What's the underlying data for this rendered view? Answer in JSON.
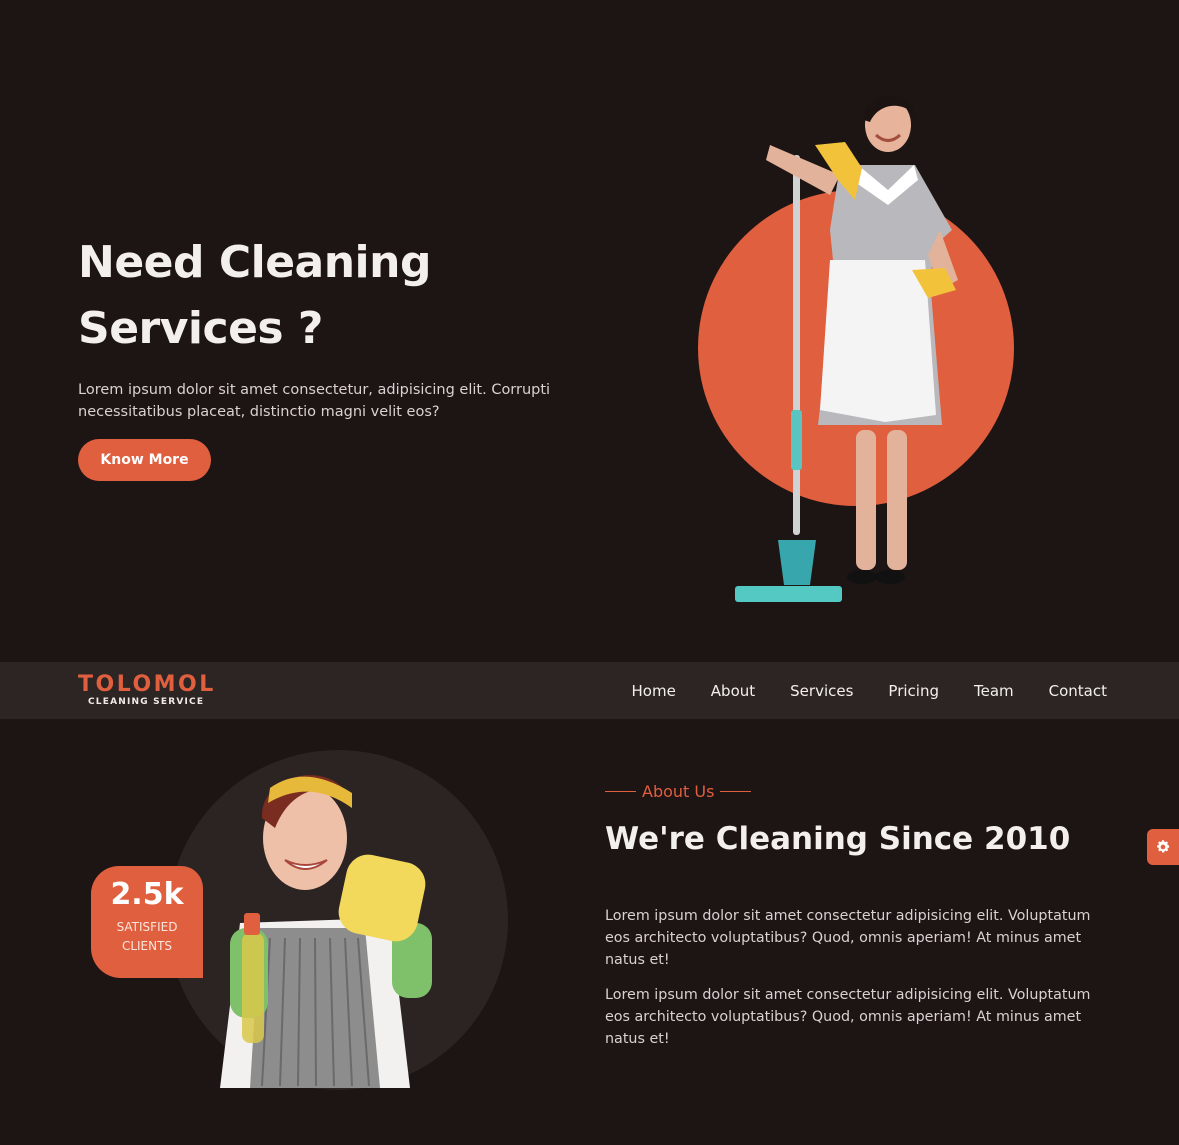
{
  "hero": {
    "title_line1": "Need Cleaning",
    "title_line2": "Services ?",
    "text": "Lorem ipsum dolor sit amet consectetur, adipisicing elit. Corrupti necessitatibus placeat, distinctio magni velit eos?",
    "button_label": "Know More"
  },
  "nav": {
    "logo_main": "TOLOMOL",
    "logo_sub": "CLEANING SERVICE",
    "links": [
      "Home",
      "About",
      "Services",
      "Pricing",
      "Team",
      "Contact"
    ]
  },
  "about": {
    "eyebrow": "About Us",
    "title": "We're Cleaning Since 2010",
    "paragraph1": "Lorem ipsum dolor sit amet consectetur adipisicing elit. Voluptatum eos architecto voluptatibus? Quod, omnis aperiam! At minus amet natus et!",
    "paragraph2": "Lorem ipsum dolor sit amet consectetur adipisicing elit. Voluptatum eos architecto voluptatibus? Quod, omnis aperiam! At minus amet natus et!",
    "stat_value": "2.5k",
    "stat_label": "SATISFIED CLIENTS"
  },
  "colors": {
    "background": "#1d1414",
    "navbar": "#2d2524",
    "accent": "#e05f3e",
    "text": "#f3efed"
  },
  "icons": {
    "settings": "gear-icon"
  }
}
